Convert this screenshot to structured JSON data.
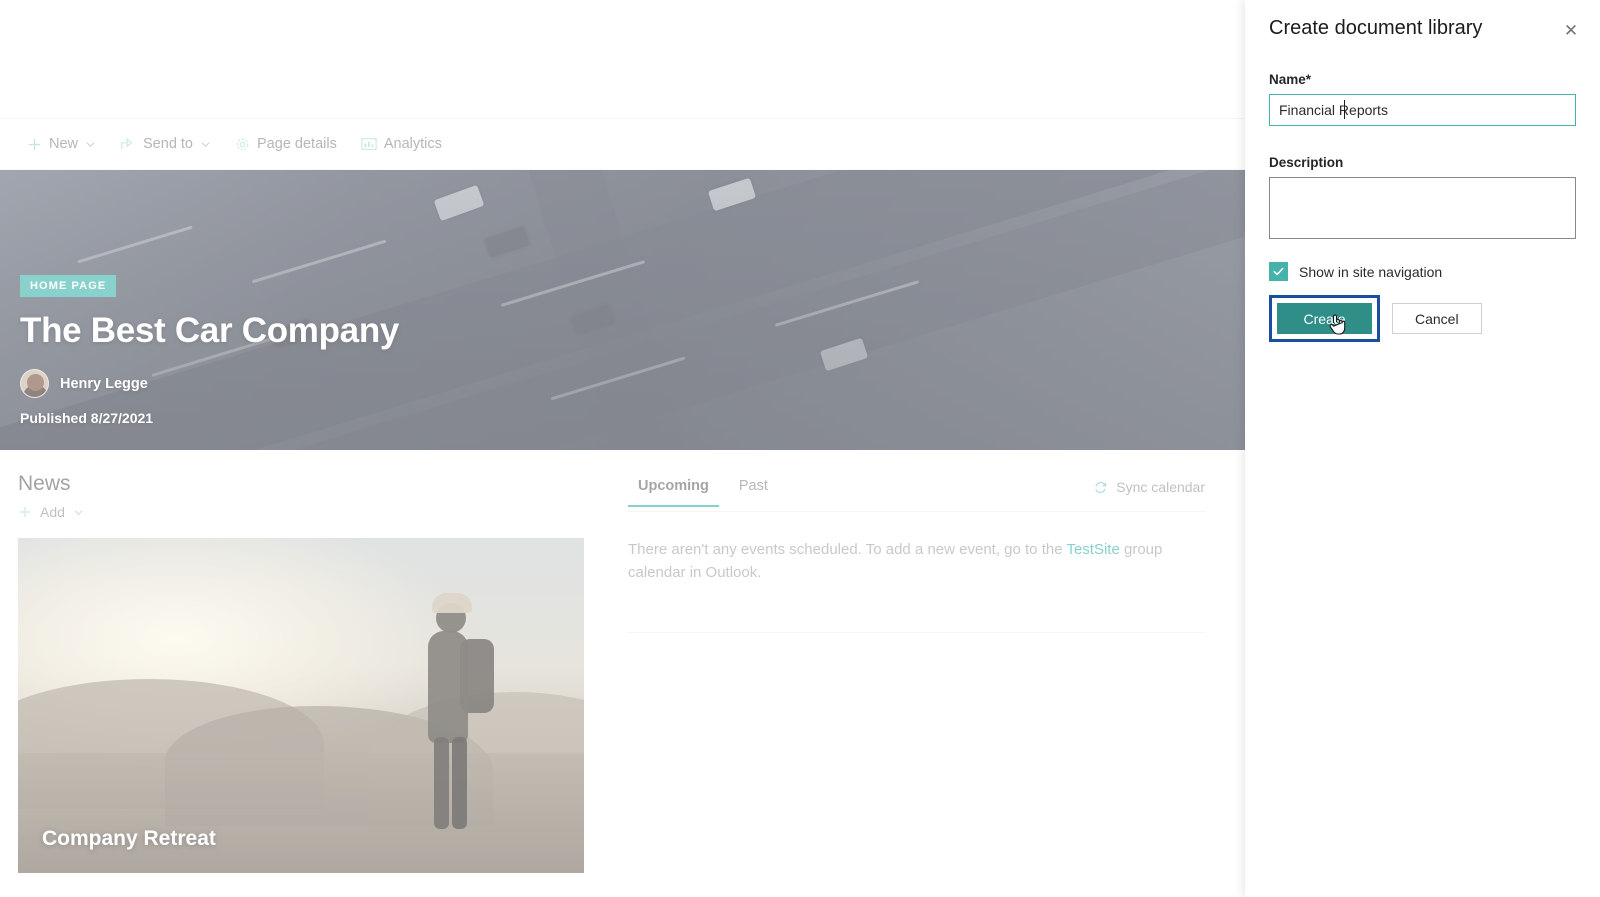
{
  "commandbar": {
    "items": [
      {
        "label": "New",
        "icon": "plus-icon",
        "has_chevron": true
      },
      {
        "label": "Send to",
        "icon": "share-icon",
        "has_chevron": true
      },
      {
        "label": "Page details",
        "icon": "gear-icon",
        "has_chevron": false
      },
      {
        "label": "Analytics",
        "icon": "analytics-icon",
        "has_chevron": false
      }
    ]
  },
  "hero": {
    "badge": "HOME PAGE",
    "title": "The Best Car Company",
    "author": "Henry Legge",
    "published": "Published 8/27/2021",
    "image_alt": "aerial-highway-interchange"
  },
  "news": {
    "section_title": "News",
    "add_label": "Add",
    "card": {
      "caption": "Company Retreat",
      "image_alt": "hiker-on-mountain-at-sunrise"
    }
  },
  "events": {
    "tabs": [
      {
        "label": "Upcoming",
        "active": true
      },
      {
        "label": "Past",
        "active": false
      }
    ],
    "sync_label": "Sync calendar",
    "empty_text_before": "There aren't any events scheduled. To add a new event, go to the ",
    "empty_link": "TestSite",
    "empty_text_after": " group calendar in Outlook."
  },
  "panel": {
    "title": "Create document library",
    "close_label": "✕",
    "name_label": "Name",
    "name_required_mark": "*",
    "name_value": "Financial Reports",
    "description_label": "Description",
    "description_value": "",
    "checkbox_label": "Show in site navigation",
    "checkbox_checked": true,
    "create_label": "Create",
    "cancel_label": "Cancel"
  },
  "colors": {
    "teal_accent": "#41b5ae",
    "create_button": "#2f8e88",
    "highlight_blue": "#1a4fa0",
    "input_focus_border": "#45b3ab",
    "text_muted": "#9b9b9b"
  }
}
